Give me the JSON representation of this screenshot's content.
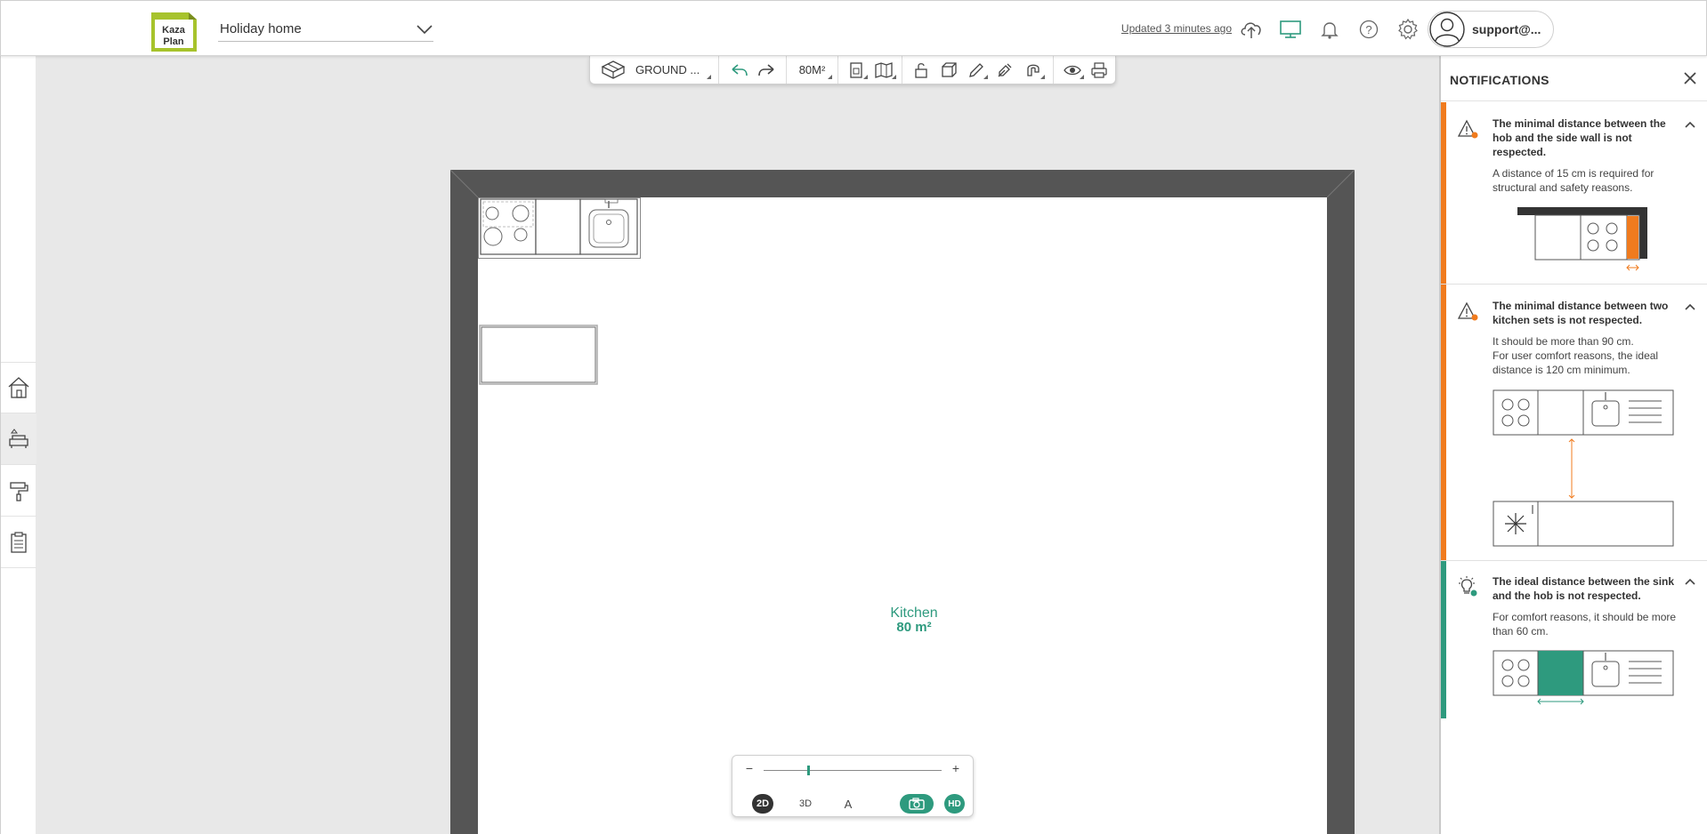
{
  "header": {
    "project_name": "Holiday home",
    "updated_text": "Updated 3 minutes ago",
    "user_name": "support@...",
    "logo_text_top": "Kaza",
    "logo_text_bottom": "Plan"
  },
  "toolbar": {
    "level_label": "GROUND ...",
    "area_label": "80M²"
  },
  "room": {
    "name": "Kitchen",
    "area": "80 m²"
  },
  "view_controls": {
    "zoom_minus": "−",
    "zoom_plus": "+",
    "zoom_level": 0.25,
    "mode_2d": "2D",
    "mode_3d": "3D",
    "mode_text": "A",
    "hd_label": "HD",
    "active_mode": "2D"
  },
  "notifications": {
    "title": "NOTIFICATIONS",
    "items": [
      {
        "type": "warning",
        "title": "The minimal distance between the hob and the side wall is not respected.",
        "body": "A distance of 15 cm is required for structural and safety reasons."
      },
      {
        "type": "warning",
        "title": "The minimal distance between two kitchen sets is not respected.",
        "body": "It should be more than 90 cm.\nFor user comfort reasons, the ideal distance is 120 cm minimum."
      },
      {
        "type": "tip",
        "title": "The ideal distance between the sink and the hob is not respected.",
        "body": "For comfort reasons, it should be more than 60 cm."
      }
    ]
  },
  "colors": {
    "accent_green": "#2e9a7e",
    "warning_orange": "#f07b1e",
    "wall_gray": "#555555",
    "logo_green": "#a7c32c"
  },
  "icons": {
    "header": [
      "cloud-upload-icon",
      "display-icon",
      "bell-icon",
      "help-icon",
      "gear-icon",
      "user-icon"
    ],
    "rail": [
      "house-icon",
      "sofa-icon",
      "paint-roller-icon",
      "clipboard-icon"
    ]
  }
}
